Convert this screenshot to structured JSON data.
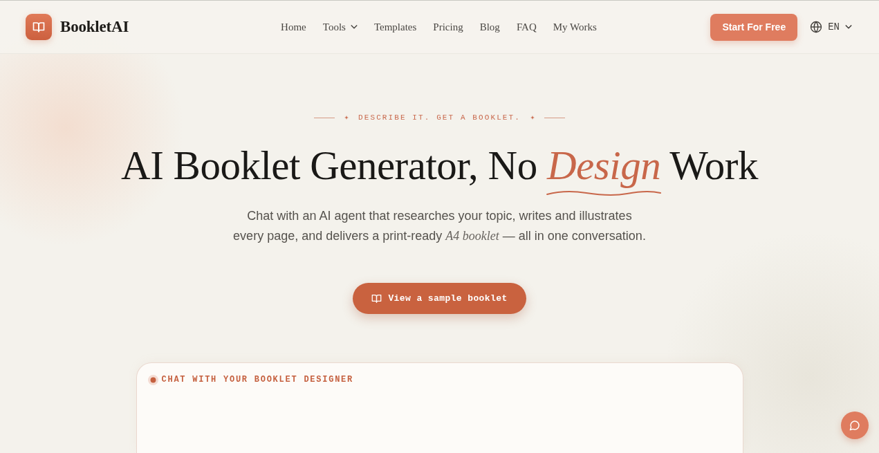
{
  "brand": {
    "name": "BookletAI"
  },
  "nav": {
    "links": [
      {
        "label": "Home",
        "kind": "link"
      },
      {
        "label": "Tools",
        "kind": "dropdown"
      },
      {
        "label": "Templates",
        "kind": "link"
      },
      {
        "label": "Pricing",
        "kind": "link"
      },
      {
        "label": "Blog",
        "kind": "link"
      },
      {
        "label": "FAQ",
        "kind": "link"
      },
      {
        "label": "My Works",
        "kind": "link"
      }
    ],
    "cta": "Start For Free",
    "language": {
      "label": "EN"
    }
  },
  "hero": {
    "eyebrow": "DESCRIBE IT. GET A BOOKLET.",
    "heading": "AI Booklet Generator, No *Design* Work",
    "subtitle": "Chat with an AI agent that researches your topic, writes and illustrates every page, and delivers a print-ready *A4 booklet* — all in one conversation.",
    "button": "View a sample booklet"
  },
  "chat_panel": {
    "label": "CHAT WITH YOUR BOOKLET DESIGNER"
  }
}
